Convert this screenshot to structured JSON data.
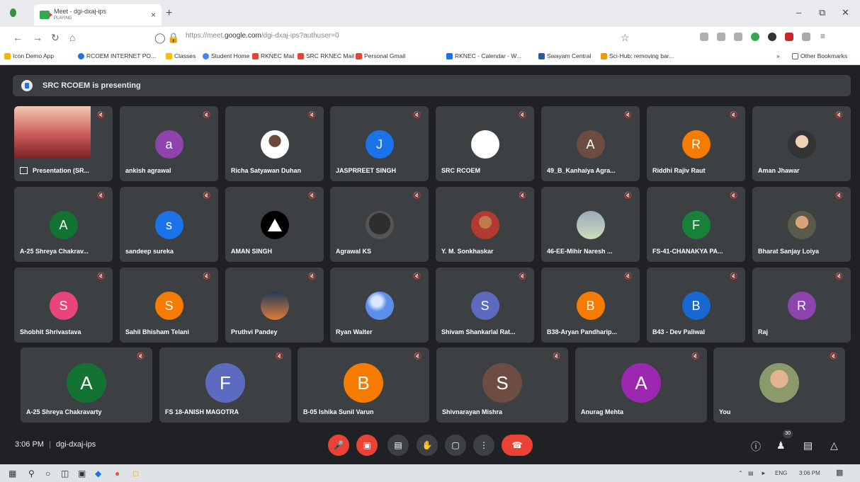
{
  "browser": {
    "tab_title": "Meet - dgi-dxaj-ips",
    "tab_subtitle": "PLAYING",
    "tab_close": "×",
    "new_tab": "+",
    "url_prefix": "https://meet.",
    "url_domain": "google.com",
    "url_path": "/dgi-dxaj-ips?authuser=0",
    "bookmarks": [
      {
        "label": "Icon Demo App",
        "color": "#f4b400"
      },
      {
        "label": "RCOEM INTERNET PO...",
        "color": "#1a73e8"
      },
      {
        "label": "Classes",
        "color": "#fbbc04"
      },
      {
        "label": "Student Home",
        "color": "#4285f4"
      },
      {
        "label": "RKNEC Mail",
        "color": "#ea4335"
      },
      {
        "label": "SRC RKNEC Mail",
        "color": "#ea4335"
      },
      {
        "label": "Personal Gmail",
        "color": "#ea4335"
      },
      {
        "label": "RKNEC - Calendar - W...",
        "color": "#1a73e8"
      },
      {
        "label": "Swayam Central",
        "color": "#2b58a8"
      },
      {
        "label": "Sci-Hub: removing bar...",
        "color": "#f29900"
      }
    ],
    "other_bookmarks": "Other Bookmarks"
  },
  "meet": {
    "presenting_text": "SRC RCOEM is presenting",
    "participants": [
      {
        "name": "Presentation (SR...",
        "type": "presentation"
      },
      {
        "name": "ankish agrawal",
        "initial": "a",
        "color": "#8e44ad"
      },
      {
        "name": "Richa Satyawan Duhan",
        "type": "photo",
        "style": "photo2"
      },
      {
        "name": "JASPRREET SINGH",
        "initial": "J",
        "color": "#1a73e8"
      },
      {
        "name": "SRC RCOEM",
        "type": "photo",
        "style": "logo-ac"
      },
      {
        "name": "49_B_Kanhaiya Agra...",
        "initial": "A",
        "color": "#6d4c41"
      },
      {
        "name": "Riddhi Rajiv Raut",
        "initial": "R",
        "color": "#f57c00"
      },
      {
        "name": "Aman Jhawar",
        "type": "photo",
        "style": "photo"
      },
      {
        "name": "A-25 Shreya Chakrav...",
        "initial": "A",
        "color": "#137333"
      },
      {
        "name": "sandeep sureka",
        "initial": "s",
        "color": "#1a73e8"
      },
      {
        "name": "AMAN SINGH",
        "type": "photo",
        "style": "logo-sv"
      },
      {
        "name": "Agrawal KS",
        "type": "photo",
        "style": "photo3"
      },
      {
        "name": "Y. M. Sonkhaskar",
        "type": "photo",
        "style": "photo4"
      },
      {
        "name": "46-EE-Mihir Naresh ...",
        "type": "photo",
        "style": "photo5"
      },
      {
        "name": "FS-41-CHANAKYA PA...",
        "initial": "F",
        "color": "#188038"
      },
      {
        "name": "Bharat Sanjay Loiya",
        "type": "photo",
        "style": "photo6"
      },
      {
        "name": "Shobhit Shrivastava",
        "initial": "S",
        "color": "#e8457a"
      },
      {
        "name": "Sahil Bhisham Telani",
        "initial": "S",
        "color": "#f57c00"
      },
      {
        "name": "Pruthvi Pandey",
        "type": "photo",
        "style": "photo7"
      },
      {
        "name": "Ryan Walter",
        "type": "photo",
        "style": "photo8"
      },
      {
        "name": "Shivam Shankarlal Rat...",
        "initial": "S",
        "color": "#5c6bc0"
      },
      {
        "name": "B38-Aryan Pandharip...",
        "initial": "B",
        "color": "#f57c00"
      },
      {
        "name": "B43 - Dev Paliwal",
        "initial": "B",
        "color": "#1967d2"
      },
      {
        "name": "Raj",
        "initial": "R",
        "color": "#8e44ad"
      },
      {
        "name": "A-25 Shreya Chakravarty",
        "initial": "A",
        "color": "#137333"
      },
      {
        "name": "FS 18-ANISH MAGOTRA",
        "initial": "F",
        "color": "#5c6bc0"
      },
      {
        "name": "B-05 Ishika Sunil Varun",
        "initial": "B",
        "color": "#f57c00"
      },
      {
        "name": "Shivnarayan Mishra",
        "initial": "S",
        "color": "#6d4c41"
      },
      {
        "name": "Anurag Mehta",
        "initial": "A",
        "color": "#9c27b0"
      },
      {
        "name": "You",
        "type": "photo",
        "style": "photo9"
      }
    ],
    "time": "3:06 PM",
    "separator": "|",
    "meeting_code": "dgi-dxaj-ips",
    "participant_count": "30"
  },
  "taskbar": {
    "language": "ENG",
    "clock": "3:06 PM"
  }
}
